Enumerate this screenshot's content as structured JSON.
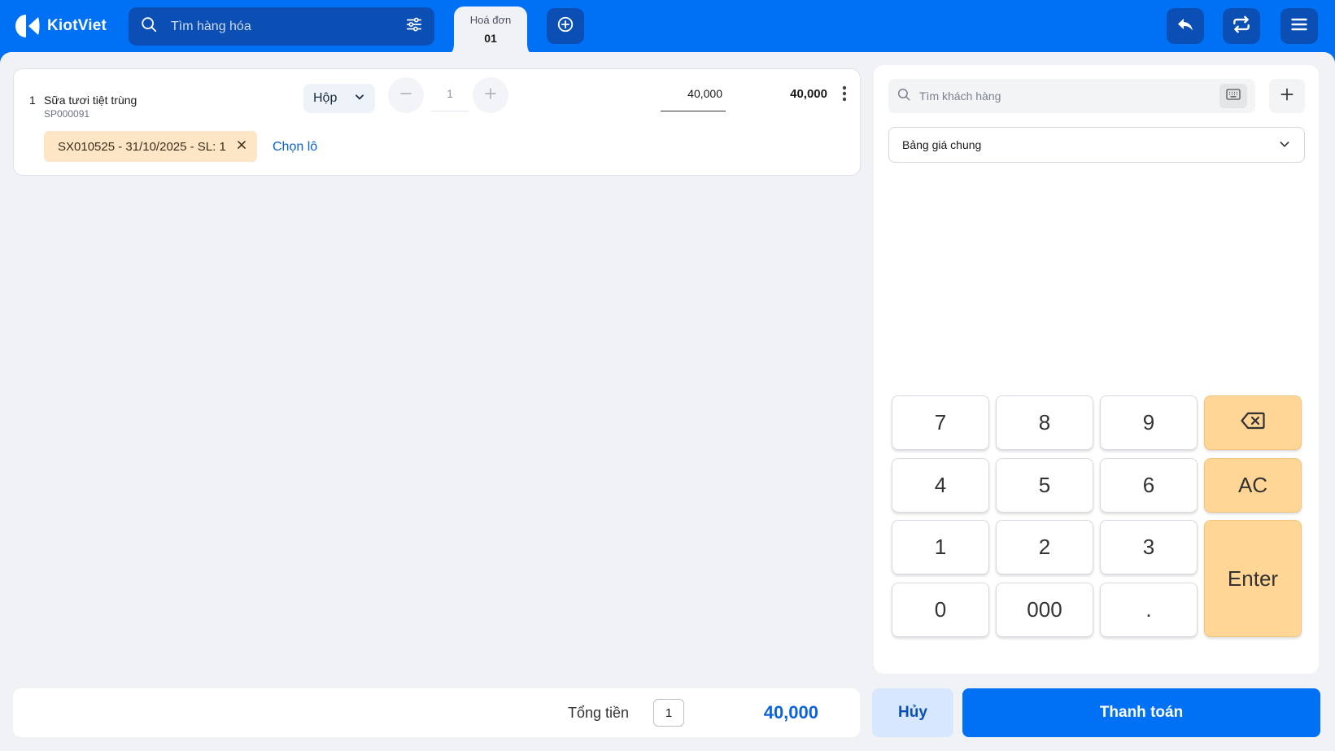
{
  "header": {
    "logo_text": "KiotViet",
    "search_placeholder": "Tìm hàng hóa",
    "tab": {
      "label": "Hoá đơn",
      "number": "01"
    }
  },
  "cart": {
    "items": [
      {
        "index": "1",
        "name": "Sữa tươi tiệt trùng",
        "code": "SP000091",
        "unit": "Hộp",
        "quantity": "1",
        "price": "40,000",
        "total": "40,000",
        "lot": "SX010525 - 31/10/2025 - SL: 1",
        "choose_lot_label": "Chọn lô"
      }
    ]
  },
  "customer": {
    "search_placeholder": "Tìm khách hàng",
    "pricebook": "Bảng giá chung"
  },
  "keypad": {
    "k7": "7",
    "k8": "8",
    "k9": "9",
    "k4": "4",
    "k5": "5",
    "k6": "6",
    "k1": "1",
    "k2": "2",
    "k3": "3",
    "k0": "0",
    "k000": "000",
    "kdot": ".",
    "clear": "AC",
    "enter": "Enter"
  },
  "summary": {
    "total_label": "Tổng tiền",
    "total_quantity": "1",
    "total_amount": "40,000"
  },
  "actions": {
    "cancel": "Hủy",
    "pay": "Thanh toán"
  },
  "colors": {
    "brand": "#0070f4",
    "accent_dark": "#0b4fb5",
    "key_orange": "#ffd696",
    "lot_chip": "#fde6c6",
    "total_amount": "#0b63dd"
  }
}
